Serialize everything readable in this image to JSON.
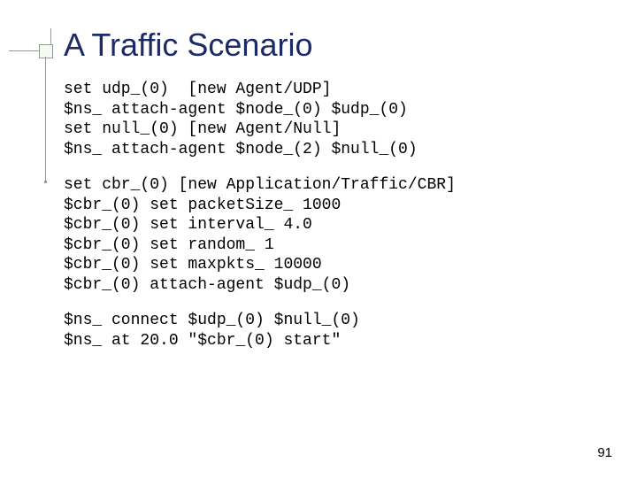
{
  "title": "A Traffic Scenario",
  "code": {
    "block1": "set udp_(0)  [new Agent/UDP]\n$ns_ attach-agent $node_(0) $udp_(0)\nset null_(0) [new Agent/Null]\n$ns_ attach-agent $node_(2) $null_(0)",
    "block2": "set cbr_(0) [new Application/Traffic/CBR]\n$cbr_(0) set packetSize_ 1000\n$cbr_(0) set interval_ 4.0\n$cbr_(0) set random_ 1\n$cbr_(0) set maxpkts_ 10000\n$cbr_(0) attach-agent $udp_(0)",
    "block3": "$ns_ connect $udp_(0) $null_(0)\n$ns_ at 20.0 \"$cbr_(0) start\""
  },
  "pagenum": "91"
}
